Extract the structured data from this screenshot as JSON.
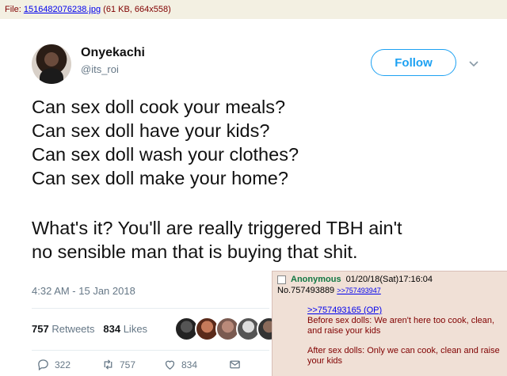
{
  "file_info": {
    "prefix": "File: ",
    "filename": "1516482076238.jpg",
    "meta": " (61 KB, 664x558)"
  },
  "tweet": {
    "name": "Onyekachi",
    "handle": "@its_roi",
    "follow_label": "Follow",
    "lines": [
      "Can sex doll cook your meals?",
      "Can sex doll have your kids?",
      "Can sex doll wash your clothes?",
      "Can sex doll make your home?"
    ],
    "lines2": [
      "What's it? You'll are really triggered TBH ain't",
      "no sensible man that is buying that shit."
    ],
    "timestamp": "4:32 AM - 15 Jan 2018",
    "retweets_count": "757",
    "retweets_label": "Retweets",
    "likes_count": "834",
    "likes_label": "Likes",
    "actions": {
      "replies": "322",
      "retweets": "757",
      "likes": "834"
    }
  },
  "chan_post": {
    "name": "Anonymous",
    "datetime": "01/20/18(Sat)17:16:04",
    "post_no": "No.757493889",
    "reply_link": ">>757493947",
    "quote": ">>757493165 (OP)",
    "para1": "Before sex dolls: We aren't here too cook, clean, and raise your kids",
    "para2": "After sex dolls: Only we can cook, clean and raise your kids"
  },
  "colors": {
    "twitter_blue": "#1da1f2",
    "chan_bg": "#f0e0d6",
    "anon_green": "#117743"
  }
}
